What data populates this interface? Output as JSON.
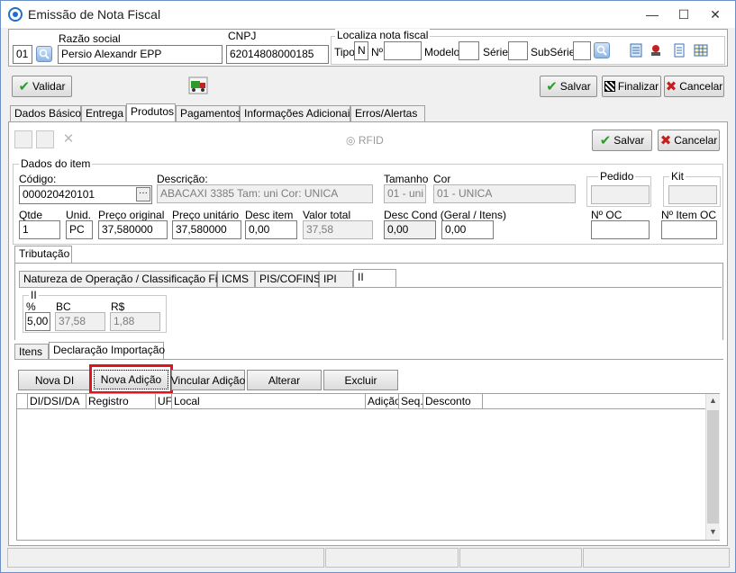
{
  "window": {
    "title": "Emissão de Nota Fiscal",
    "minimize": "—",
    "maximize": "☐",
    "close": "✕"
  },
  "header": {
    "razao_social_label": "Razão social",
    "cnpj_label": "CNPJ",
    "empresa_code": "01",
    "razao_social": "Persio Alexandr EPP",
    "cnpj": "62014808000185",
    "localiza_label": "Localiza nota fiscal",
    "tipo_label": "Tipo",
    "tipo_value": "N",
    "numero_label": "Nº",
    "modelo_label": "Modelo",
    "serie_label": "Série",
    "subserie_label": "SubSérie"
  },
  "toolbar": {
    "validar": "Validar",
    "salvar": "Salvar",
    "finalizar": "Finalizar",
    "cancelar": "Cancelar"
  },
  "tabs": [
    "Dados Básicos",
    "Entrega",
    "Produtos",
    "Pagamentos",
    "Informações Adicionais",
    "Erros/Alertas"
  ],
  "produtos": {
    "rfid": "RFID",
    "salvar": "Salvar",
    "cancelar": "Cancelar",
    "dados_item_title": "Dados do item",
    "codigo_label": "Código:",
    "codigo": "000020420101",
    "codigo_btn": "···",
    "descricao_label": "Descrição:",
    "descricao": "ABACAXI 3385 Tam: uni Cor: UNICA",
    "tamanho_label": "Tamanho",
    "tamanho": "01 - uni",
    "cor_label": "Cor",
    "cor": "01 - UNICA",
    "pedido_label": "Pedido",
    "kit_label": "Kit",
    "qtde_label": "Qtde",
    "qtde": "1",
    "unid_label": "Unid.",
    "unid": "PC",
    "preco_original_label": "Preço original",
    "preco_original": "37,580000",
    "preco_unitario_label": "Preço unitário",
    "preco_unitario": "37,580000",
    "desc_item_label": "Desc item",
    "desc_item": "0,00",
    "valor_total_label": "Valor total",
    "valor_total": "37,58",
    "desc_cond_label": "Desc Cond (Geral / Itens)",
    "desc_cond_geral": "0,00",
    "desc_cond_itens": "0,00",
    "no_oc_label": "Nº OC",
    "no_item_oc_label": "Nº Item OC"
  },
  "tributacao": {
    "tab": "Tributação",
    "subtabs": [
      "Natureza de Operação / Classificação Fiscal",
      "ICMS",
      "PIS/COFINS",
      "IPI",
      "II"
    ],
    "ii_group": "II",
    "pct_label": "%",
    "pct": "5,00",
    "bc_label": "BC",
    "bc": "37,58",
    "rs_label": "R$",
    "rs": "1,88"
  },
  "lower_tabs": [
    "Itens",
    "Declaração Importação"
  ],
  "di_buttons": {
    "nova_di": "Nova DI",
    "nova_adicao": "Nova Adição",
    "vincular_adicao": "Vincular Adição",
    "alterar": "Alterar",
    "excluir": "Excluir"
  },
  "grid_columns": [
    "DI/DSI/DA",
    "Registro",
    "UF",
    "Local",
    "Adição",
    "Seq.",
    "Desconto"
  ],
  "colors": {
    "highlight": "#e0141e",
    "accent": "#2e9a2e",
    "cancel": "#c42020"
  }
}
